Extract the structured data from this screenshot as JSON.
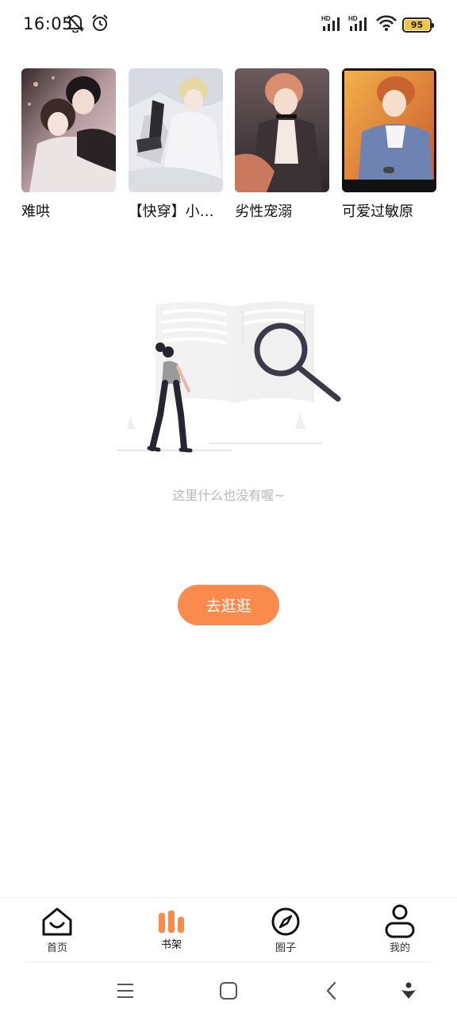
{
  "status_bar": {
    "time": "16:05",
    "battery": "95",
    "icons": [
      "bell-muted-icon",
      "alarm-icon",
      "signal-hd-icon",
      "signal-hd-icon",
      "wifi-icon",
      "battery-icon"
    ]
  },
  "books": [
    {
      "title": "难哄"
    },
    {
      "title": "【快穿】小…"
    },
    {
      "title": "劣性宠溺"
    },
    {
      "title": "可爱过敏原"
    }
  ],
  "empty_state": {
    "message": "这里什么也没有喔~",
    "button_label": "去逛逛"
  },
  "tab_bar": {
    "tabs": [
      {
        "label": "首页",
        "icon": "home-icon"
      },
      {
        "label": "书架",
        "icon": "bookshelf-icon",
        "active": true
      },
      {
        "label": "圈子",
        "icon": "compass-icon"
      },
      {
        "label": "我的",
        "icon": "profile-icon"
      }
    ]
  },
  "colors": {
    "accent": "#fb8a4d",
    "active_tab": "#fb8a4d",
    "hint_text": "#b7b7b7"
  }
}
